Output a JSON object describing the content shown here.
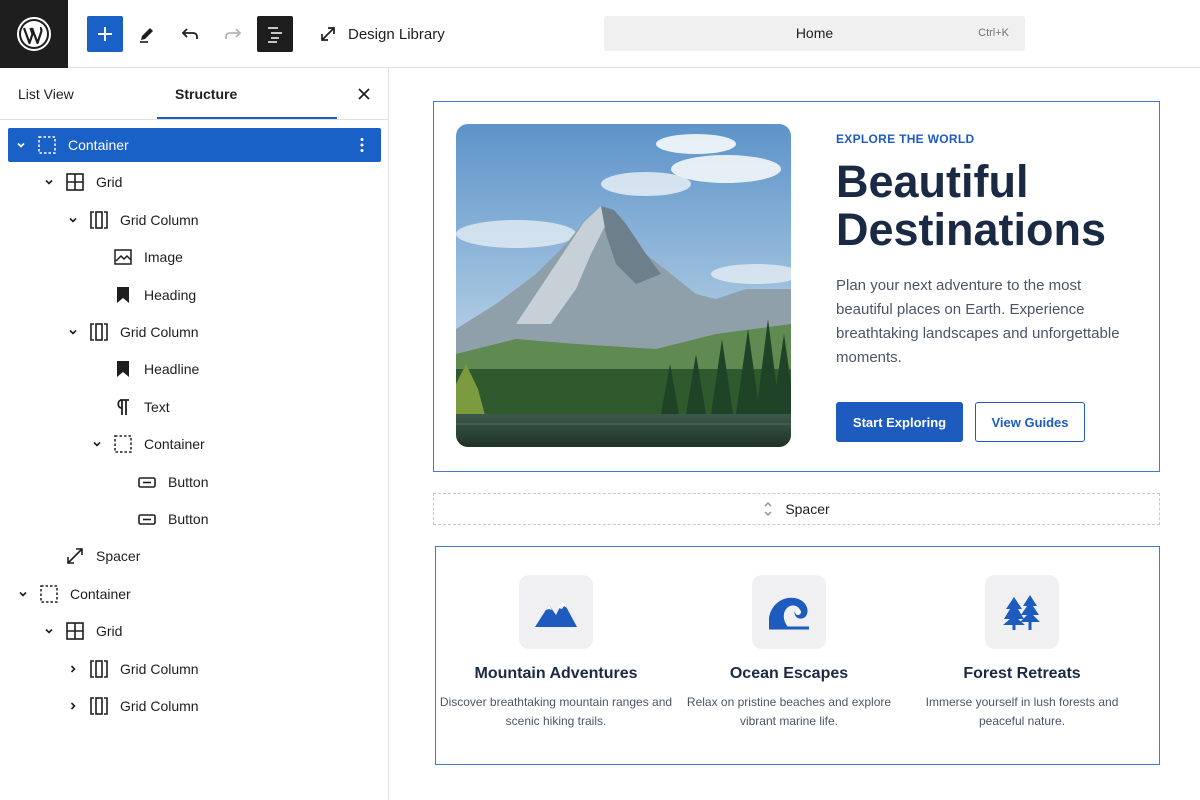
{
  "toolbar": {
    "design_library_label": "Design Library",
    "command_title": "Home",
    "command_shortcut": "Ctrl+K"
  },
  "sidebar": {
    "tabs": [
      {
        "label": "List View",
        "active": false
      },
      {
        "label": "Structure",
        "active": true
      }
    ],
    "tree": [
      {
        "label": "Container",
        "icon": "container-icon",
        "depth": 0,
        "chevron": "down",
        "selected": true
      },
      {
        "label": "Grid",
        "icon": "grid-icon",
        "depth": 1,
        "chevron": "down"
      },
      {
        "label": "Grid Column",
        "icon": "grid-column-icon",
        "depth": 2,
        "chevron": "down"
      },
      {
        "label": "Image",
        "icon": "image-icon",
        "depth": 3,
        "chevron": "none"
      },
      {
        "label": "Heading",
        "icon": "bookmark-icon",
        "depth": 3,
        "chevron": "none"
      },
      {
        "label": "Grid Column",
        "icon": "grid-column-icon",
        "depth": 2,
        "chevron": "down"
      },
      {
        "label": "Headline",
        "icon": "bookmark-icon",
        "depth": 3,
        "chevron": "none"
      },
      {
        "label": "Text",
        "icon": "paragraph-icon",
        "depth": 3,
        "chevron": "none"
      },
      {
        "label": "Container",
        "icon": "container-icon",
        "depth": 3,
        "chevron": "down"
      },
      {
        "label": "Button",
        "icon": "button-icon",
        "depth": 4,
        "chevron": "none"
      },
      {
        "label": "Button",
        "icon": "button-icon",
        "depth": 4,
        "chevron": "none"
      },
      {
        "label": "Spacer",
        "icon": "spacer-icon",
        "depth": 1,
        "chevron": "none"
      },
      {
        "label": "Container",
        "icon": "container-icon",
        "depth": 0,
        "chevron": "down"
      },
      {
        "label": "Grid",
        "icon": "grid-icon",
        "depth": 1,
        "chevron": "down"
      },
      {
        "label": "Grid Column",
        "icon": "grid-column-icon",
        "depth": 2,
        "chevron": "right"
      },
      {
        "label": "Grid Column",
        "icon": "grid-column-icon",
        "depth": 2,
        "chevron": "right"
      }
    ]
  },
  "hero": {
    "eyebrow": "EXPLORE THE WORLD",
    "title": "Beautiful Destinations",
    "description": "Plan your next adventure to the most beautiful places on Earth. Experience breathtaking landscapes and unforgettable moments.",
    "primary_button": "Start Exploring",
    "secondary_button": "View Guides"
  },
  "spacer_label": "Spacer",
  "features": [
    {
      "title": "Mountain Adventures",
      "description": "Discover breathtaking mountain ranges and scenic hiking trails.",
      "icon": "mountain-icon"
    },
    {
      "title": "Ocean Escapes",
      "description": "Relax on pristine beaches and explore vibrant marine life.",
      "icon": "wave-icon"
    },
    {
      "title": "Forest Retreats",
      "description": "Immerse yourself in lush forests and peaceful nature.",
      "icon": "trees-icon"
    }
  ],
  "colors": {
    "accent": "#1a61c7",
    "brand_blue": "#1e5bbf",
    "heading": "#1b2a44",
    "toolbar_dark": "#1e1e1e"
  }
}
